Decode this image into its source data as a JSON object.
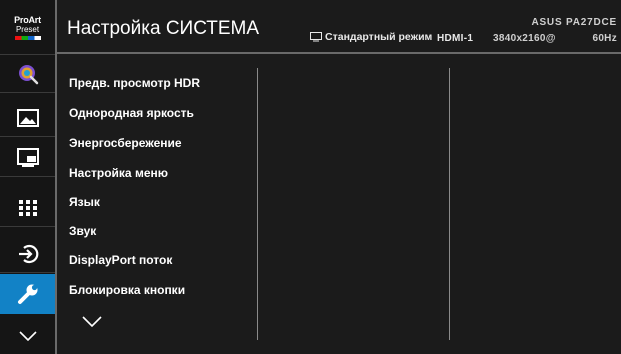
{
  "header": {
    "title": "Настройка СИСТЕМА",
    "mode_icon": "monitor-icon",
    "mode": "Стандартный режим",
    "input": "HDMI-1",
    "model": "ASUS PA27DCE",
    "resolution": "3840x2160@",
    "refresh": "60Hz"
  },
  "rail": {
    "preset_title": "ProArt",
    "preset_sub": "Preset",
    "items": [
      {
        "icon": "color-palette-icon"
      },
      {
        "icon": "image-icon"
      },
      {
        "icon": "pip-icon"
      },
      {
        "icon": "apps-grid-icon"
      },
      {
        "icon": "input-select-icon"
      },
      {
        "icon": "wrench-icon",
        "active": true
      },
      {
        "icon": "chevron-down-icon"
      }
    ],
    "accent": "#1282c6"
  },
  "menu": {
    "items": [
      "Предв. просмотр HDR",
      "Однородная яркость",
      "Энергосбережение",
      "Настройка меню",
      "Язык",
      "Звук",
      "DisplayPort поток",
      "Блокировка кнопки"
    ],
    "more_icon": "chevron-down-icon"
  }
}
